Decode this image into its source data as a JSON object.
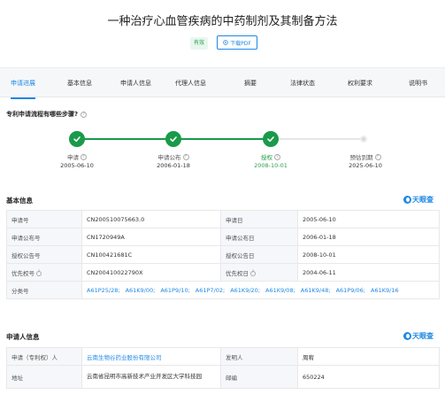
{
  "page": {
    "title": "一种治疗心血管疾病的中药制剂及其制备方法",
    "status": "有效",
    "pdf_label": "下载PDF"
  },
  "tabs": [
    "申请进展",
    "基本信息",
    "申请人信息",
    "代理人信息",
    "摘要",
    "法律状态",
    "权利要求",
    "说明书"
  ],
  "progress": {
    "question": "专利申请流程有哪些步骤?",
    "steps": [
      {
        "label": "申请",
        "date": "2005-06-10"
      },
      {
        "label": "申请公布",
        "date": "2006-01-18"
      },
      {
        "label": "授权",
        "date": "2008-10-01"
      },
      {
        "label": "预估到期",
        "date": "2025-06-10"
      }
    ]
  },
  "basic_info": {
    "title": "基本信息",
    "brand": "天眼查",
    "rows": [
      {
        "l1": "申请号",
        "v1": "CN200510075663.0",
        "l2": "申请日",
        "v2": "2005-06-10"
      },
      {
        "l1": "申请公布号",
        "v1": "CN1720949A",
        "l2": "申请公布日",
        "v2": "2006-01-18"
      },
      {
        "l1": "授权公告号",
        "v1": "CN100421681C",
        "l2": "授权公告日",
        "v2": "2008-10-01"
      },
      {
        "l1": "优先权号",
        "v1": "CN200410022790X",
        "l2": "优先权日",
        "v2": "2004-06-11"
      }
    ],
    "class_label": "分类号",
    "classes": [
      "A61P25/28;",
      "A61K9/00;",
      "A61P9/10;",
      "A61P7/02;",
      "A61K9/20;",
      "A61K9/08;",
      "A61K9/48;",
      "A61P9/06;",
      "A61K9/16"
    ]
  },
  "applicant_info": {
    "title": "申请人信息",
    "brand": "天眼查",
    "applicant_label": "申请（专利权）人",
    "applicant": "云南生物谷药业股份有限公司",
    "inventor_label": "发明人",
    "inventor": "周宥",
    "address_label": "地址",
    "address": "云南省昆明市高新技术产业开发区大学科技园",
    "postcode_label": "邮编",
    "postcode": "650224"
  },
  "colors": {
    "accent": "#1e88e5",
    "success": "#1a9a4a",
    "pending": "#d9d9d9"
  }
}
